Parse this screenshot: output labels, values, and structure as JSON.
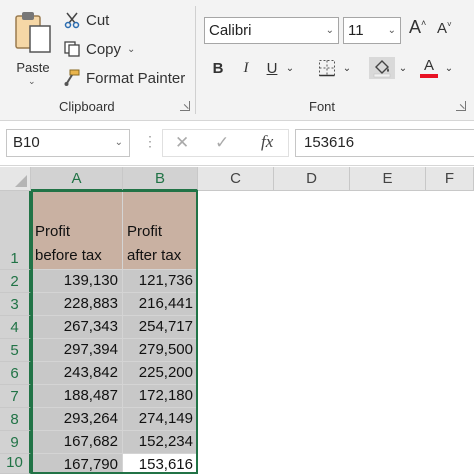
{
  "clipboard": {
    "paste_label": "Paste",
    "cut_label": "Cut",
    "copy_label": "Copy",
    "format_painter_label": "Format Painter",
    "group_label": "Clipboard"
  },
  "font": {
    "font_name": "Calibri",
    "font_size": "11",
    "bold_label": "B",
    "italic_label": "I",
    "underline_label": "U",
    "grow_label": "A",
    "shrink_label": "A",
    "font_color_label": "A",
    "group_label": "Font",
    "font_color": "#e81123"
  },
  "formula_bar": {
    "name_box": "B10",
    "fx_label": "fx",
    "cancel_symbol": "✕",
    "enter_symbol": "✓",
    "value": "153616"
  },
  "grid": {
    "columns": [
      "A",
      "B",
      "C",
      "D",
      "E",
      "F"
    ],
    "rows": [
      "1",
      "2",
      "3",
      "4",
      "5",
      "6",
      "7",
      "8",
      "9",
      "10"
    ],
    "headers": {
      "a_line1": "Profit",
      "a_line2": "before tax",
      "b_line1": "Profit",
      "b_line2": "after tax"
    },
    "data": [
      [
        "139,130",
        "121,736"
      ],
      [
        "228,883",
        "216,441"
      ],
      [
        "267,343",
        "254,717"
      ],
      [
        "297,394",
        "279,500"
      ],
      [
        "243,842",
        "225,200"
      ],
      [
        "188,487",
        "172,180"
      ],
      [
        "293,264",
        "274,149"
      ],
      [
        "167,682",
        "152,234"
      ],
      [
        "167,790",
        "153,616"
      ]
    ]
  },
  "colors": {
    "accent": "#217346",
    "header_fill": "#c9b1a2",
    "selection_fill": "#c8c8c8"
  }
}
